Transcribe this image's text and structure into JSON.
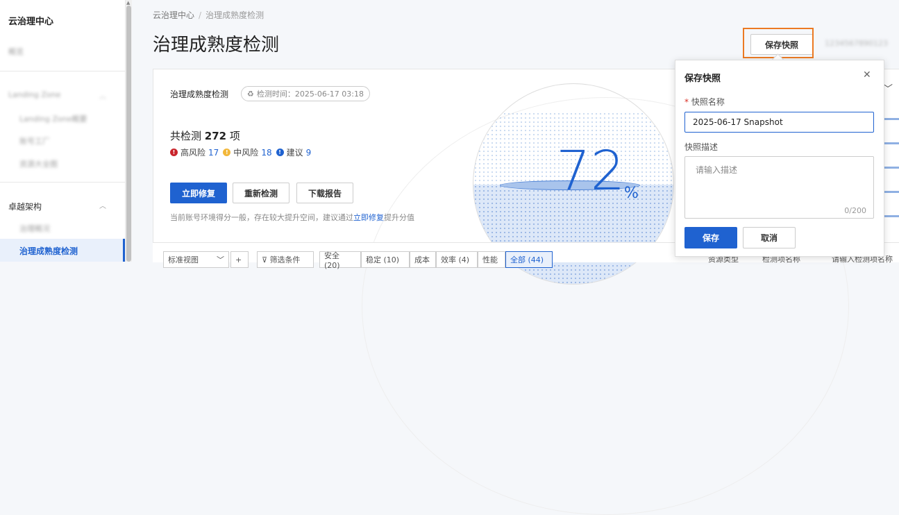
{
  "sidebar": {
    "title": "云治理中心",
    "items": [
      {
        "label": "概览",
        "blurred": true
      },
      {
        "label": "Landing Zone",
        "blurred": true
      },
      {
        "label": "Landing Zone概要",
        "blurred": true
      },
      {
        "label": "账号工厂",
        "blurred": true
      },
      {
        "label": "资源大全图",
        "blurred": true
      },
      {
        "label": "卓越架构",
        "blurred": false
      },
      {
        "label": "治理概况",
        "blurred": true
      },
      {
        "label": "治理成熟度检测",
        "blurred": false,
        "active": true
      }
    ]
  },
  "breadcrumb": {
    "root": "云治理中心",
    "separator": "/",
    "current": "治理成熟度检测"
  },
  "page_title": "治理成熟度检测",
  "header": {
    "save_snapshot_label": "保存快照",
    "account_id": "1234567890123"
  },
  "card": {
    "title": "治理成熟度检测",
    "check_time": "检测时间：2025-06-17 03:18",
    "total_prefix": "共检测",
    "total_count": "272",
    "total_suffix": "项",
    "risks": {
      "high_label": "高风险",
      "high_count": "17",
      "medium_label": "中风险",
      "medium_count": "18",
      "suggest_label": "建议",
      "suggest_count": "9"
    },
    "buttons": {
      "fix_now": "立即修复",
      "recheck": "重新检测",
      "download": "下载报告"
    },
    "tip_before": "当前账号环境得分一般，存在较大提升空间，建议通过",
    "tip_link": "立即修复",
    "tip_after": "提升分值",
    "score": "72",
    "score_unit": "%"
  },
  "filter_bar": {
    "view": "标准视图",
    "filter": "筛选条件",
    "tabs": [
      "安全 (20)",
      "稳定 (10)",
      "成本",
      "效率 (4)",
      "性能",
      "全部 (44)"
    ]
  },
  "right_strip": {
    "resource_type": "资源类型",
    "check_name": "检测项名称",
    "search_placeholder": "请输入检测项名称"
  },
  "popover": {
    "title": "保存快照",
    "name_label": "快照名称",
    "name_value": "2025-06-17 Snapshot",
    "desc_label": "快照描述",
    "desc_placeholder": "请输入描述",
    "counter": "0/200",
    "save": "保存",
    "cancel": "取消"
  },
  "colors": {
    "primary": "#1f62d0",
    "highlight": "#ec7a22",
    "high_risk": "#c9252c",
    "medium_risk": "#f2b73a",
    "suggest": "#1f62d0"
  }
}
